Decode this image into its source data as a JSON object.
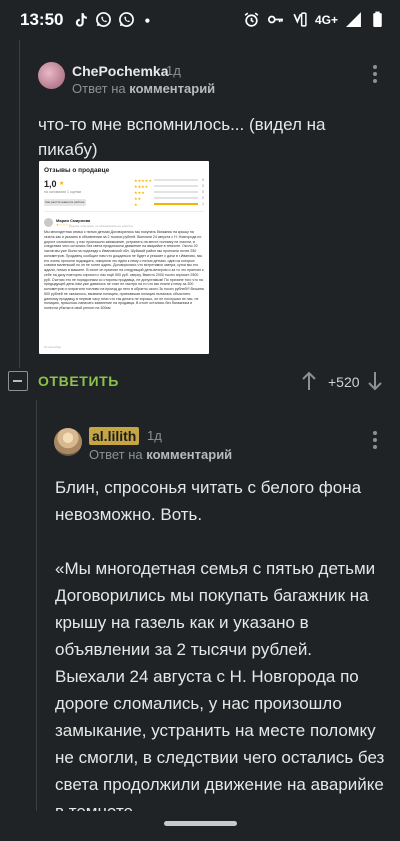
{
  "status_bar": {
    "time": "13:50",
    "network": "4G+",
    "left_icons": [
      "tiktok-icon",
      "whatsapp-icon",
      "whatsapp-icon",
      "dot-icon"
    ],
    "right_icons": [
      "alarm-icon",
      "key-icon",
      "volte-icon",
      "network-4g-icon",
      "signal-icon",
      "battery-icon"
    ]
  },
  "comment1": {
    "username": "ChePochemka",
    "time": "1д",
    "reply_prefix": "Ответ на",
    "reply_target": "комментарий",
    "text": "что-то мне вспомнилось... (видел на пикабу)",
    "image": {
      "title": "Отзывы о продавце",
      "score": "1,0",
      "score_sub": "на основании 1 оценки",
      "breakdown": [
        {
          "stars": "★★★★★",
          "count": "0"
        },
        {
          "stars": "★★★★",
          "count": "0"
        },
        {
          "stars": "★★★",
          "count": "0"
        },
        {
          "stars": "★★",
          "count": "0"
        },
        {
          "stars": "★",
          "count": "1"
        }
      ],
      "button": "Как рассчитывается рейтинг",
      "reviewer": "Мария Смирнова",
      "review_meta": "Сделка отменена, по объявлению на «Авито»",
      "review_text": "Мы многодетная семья с пятью детьми Договорились мы покупать багажник на крышу на газель как и указано в объявлении за 2 тысячи рублей. Выехали 24 августа с Н. Новгорода по дороге сломались, у нас произошло замыкание, устранить на месте поломку не смогли, в следствии чего остались без света продолжили движение на аварийке в темноте. Около 20 часов мы уже были на подъезде к Ивановской обл. Шуйский район мы проехали почти 250 километров. Продавец сообщил нам что дождаться не будет и уезжает с дачи в г.Иваново, мы его очень просили подождать, говорили что едем к нему с пятью детьми, один из которых совсем маленький но он не хотел ждать. Договорились что встретимся завтра, сутки мы его ждали, ночью в машине. В итоге он приехал на следующий день вечером и за то что приехал к себе на дачу повторно спросил с нас ещё 500 руб. сверху. Вместо 2000 тысяч спросил 2500 руб. Считаю это не порядочным со стороны продавца, не допустимым! По причине того что на предыдущей день нам уже давалось не стал не смотря на то что мы ехали к нему за 300 километров и потратили топливо на проезд до него в обратно около 3к тысяч рублей!!! Вешина 500 рублей не оказалось, вызвали полицию, приехавшая полиция пыталась объяснить данному продавцу в первом часу ночи что так делать не хорошо, он не послушал их нас, не полицию, пришлось написать заявление на продавца. В итоге остались без багажника и понесли убытки в свой регион на 300км",
      "review_date": "24 сентября"
    },
    "actions": {
      "reply_label": "ОТВЕТИТЬ",
      "score": "+520"
    }
  },
  "comment2": {
    "username": "al.lilith",
    "time": "1д",
    "reply_prefix": "Ответ на",
    "reply_target": "комментарий",
    "paragraph1": "Блин, спросонья читать с белого фона невозможно. Воть.",
    "paragraph2": "«Мы многодетная семья с пятью детьми Договорились мы покупать багажник на крышу на газель как и указано в объявлении за 2 тысячи рублей. Выехали 24 августа с Н. Новгорода по дороге сломались, у нас произошло замыкание, устранить на месте поломку не смогли, в следствии чего остались без света продолжили движение на аварийке в темноте"
  },
  "colors": {
    "background": "#1f2325",
    "reply_green": "#8bc34a",
    "username_badge": "#c5a544",
    "muted": "#8c9194"
  }
}
